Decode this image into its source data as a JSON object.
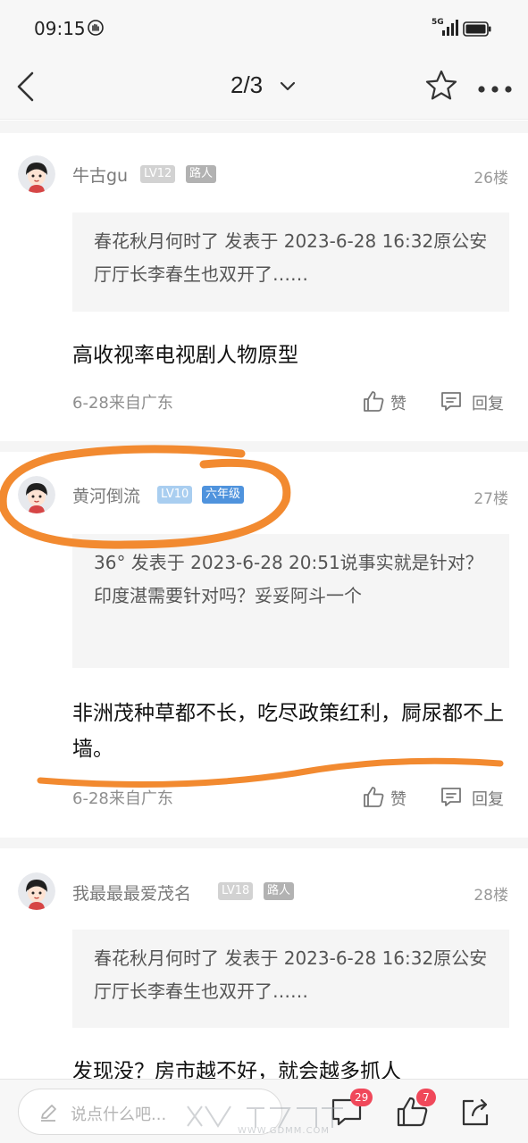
{
  "status_bar": {
    "time": "09:15",
    "network": "5G"
  },
  "nav": {
    "page_indicator": "2/3"
  },
  "posts": [
    {
      "username": "牛古gu",
      "level": "LV12",
      "title": "路人",
      "floor": "26楼",
      "quote": "春花秋月何时了 发表于 2023-6-28 16:32原公安厅厅长李春生也双开了……",
      "content": "高收视率电视剧人物原型",
      "meta": "6-28来自广东",
      "like_label": "赞",
      "reply_label": "回复"
    },
    {
      "username": "黄河倒流",
      "level": "LV10",
      "title": "六年级",
      "floor": "27楼",
      "quote": "36° 发表于 2023-6-28 20:51说事实就是针对？印度湛需要针对吗？妥妥阿斗一个",
      "content": "非洲茂种草都不长，吃尽政策红利，屙尿都不上墙。",
      "meta": "6-28来自广东",
      "like_label": "赞",
      "reply_label": "回复"
    },
    {
      "username": "我最最最爱茂名",
      "level": "LV18",
      "title": "路人",
      "floor": "28楼",
      "quote": "春花秋月何时了 发表于 2023-6-28 16:32原公安厅厅长李春生也双开了……",
      "content": "发现没？房市越不好，就会越多抓人"
    }
  ],
  "bottom_bar": {
    "input_placeholder": "说点什么吧...",
    "comment_count": "29",
    "like_count": "7"
  },
  "watermark": {
    "site": "WWW.GDMM.COM"
  },
  "colors": {
    "annotation": "#f28a30",
    "badge_red": "#f0485a",
    "level_gray": "#d2d2d2",
    "level_blue": "#a9cef0",
    "title_blue": "#4f93dd"
  }
}
